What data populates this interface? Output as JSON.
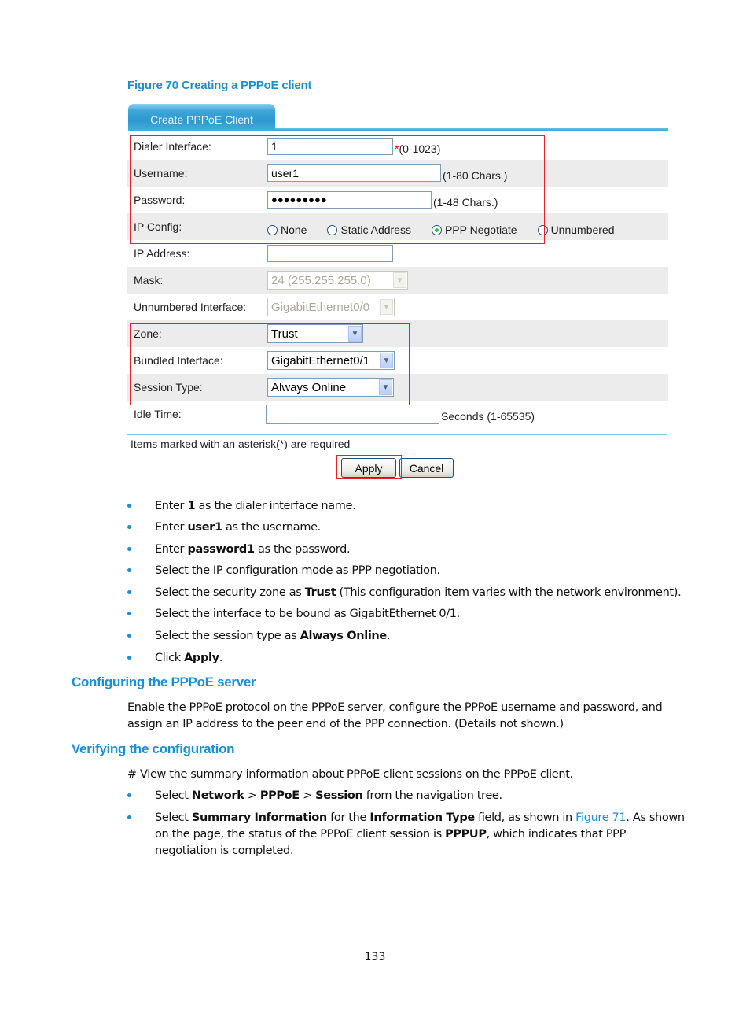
{
  "figure": {
    "caption": "Figure 70 Creating a PPPoE client"
  },
  "form": {
    "tab_label": "Create PPPoE Client",
    "dialer_interface": {
      "label": "Dialer Interface:",
      "value": "1",
      "required_mark": "*",
      "hint": "(0-1023)"
    },
    "username": {
      "label": "Username:",
      "value": "user1",
      "hint": "(1-80 Chars.)"
    },
    "password": {
      "label": "Password:",
      "masked_value": "●●●●●●●●●",
      "hint": "(1-48 Chars.)"
    },
    "ip_config": {
      "label": "IP Config:",
      "options": [
        {
          "label": "None",
          "selected": false
        },
        {
          "label": "Static Address",
          "selected": false
        },
        {
          "label": "PPP Negotiate",
          "selected": true
        },
        {
          "label": "Unnumbered",
          "selected": false
        }
      ]
    },
    "ip_address": {
      "label": "IP Address:",
      "value": ""
    },
    "mask": {
      "label": "Mask:",
      "value": "24 (255.255.255.0)",
      "disabled": true
    },
    "unnumbered_interface": {
      "label": "Unnumbered Interface:",
      "value": "GigabitEthernet0/0",
      "disabled": true
    },
    "zone": {
      "label": "Zone:",
      "value": "Trust"
    },
    "bundled_interface": {
      "label": "Bundled Interface:",
      "value": "GigabitEthernet0/1"
    },
    "session_type": {
      "label": "Session Type:",
      "value": "Always Online"
    },
    "idle_time": {
      "label": "Idle Time:",
      "value": "",
      "hint": "Seconds (1-65535)"
    },
    "required_note": "Items marked with an asterisk(*) are required",
    "apply_label": "Apply",
    "cancel_label": "Cancel",
    "highlight_color": "#e8202a",
    "accent_color": "#1a8fd4"
  },
  "steps": [
    {
      "pre": "Enter ",
      "bold": "1",
      "post": " as the dialer interface name."
    },
    {
      "pre": "Enter ",
      "bold": "user1",
      "post": " as the username."
    },
    {
      "pre": "Enter ",
      "bold": "password1",
      "post": " as the password."
    },
    {
      "pre": "Select the IP configuration mode as PPP negotiation.",
      "bold": "",
      "post": ""
    },
    {
      "pre": "Select the security zone as ",
      "bold": "Trust",
      "post": " (This configuration item varies with the network environment)."
    },
    {
      "pre": "Select the interface to be bound as GigabitEthernet 0/1.",
      "bold": "",
      "post": ""
    },
    {
      "pre": "Select the session type as ",
      "bold": "Always Online",
      "post": "."
    },
    {
      "pre": "Click ",
      "bold": "Apply",
      "post": "."
    }
  ],
  "section_server": {
    "heading": "Configuring the PPPoE server",
    "body": "Enable the PPPoE protocol on the PPPoE server, configure the PPPoE username and password, and assign an IP address to the peer end of the PPP connection. (Details not shown.)"
  },
  "section_verify": {
    "heading": "Verifying the configuration",
    "intro": "# View the summary information about PPPoE client sessions on the PPPoE client.",
    "step1": {
      "t1": "Select ",
      "b1": "Network",
      "t2": " > ",
      "b2": "PPPoE",
      "t3": " > ",
      "b3": "Session",
      "t4": " from the navigation tree."
    },
    "step2": {
      "t1": "Select ",
      "b1": "Summary Information",
      "t2": " for the ",
      "b2": "Information Type",
      "t3": " field, as shown in ",
      "link": "Figure 71",
      "t4": ". As shown on the page, the status of the PPPoE client session is ",
      "b3": "PPPUP",
      "t5": ", which indicates that PPP negotiation is completed."
    }
  },
  "page_number": "133"
}
